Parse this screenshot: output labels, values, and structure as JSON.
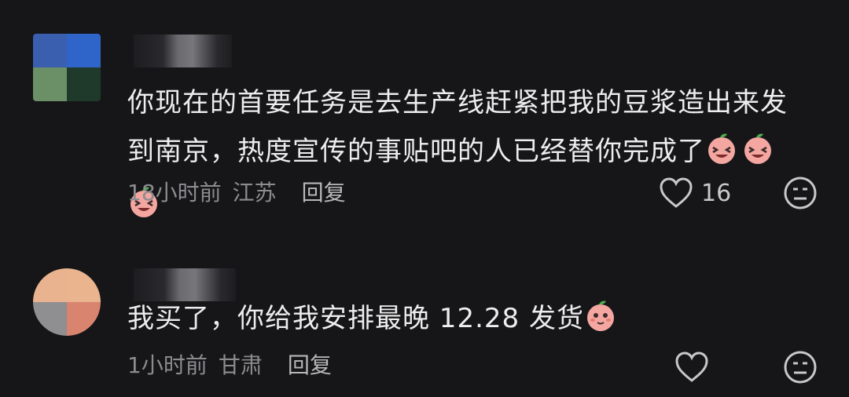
{
  "colors": {
    "background": "#161619",
    "text": "#ededed",
    "meta": "#8c8c8f",
    "emoji": "#f3a7a0"
  },
  "comments": [
    {
      "text": "你现在的首要任务是去生产线赶紧把我的豆浆造出来发到南京，热度宣传的事贴吧的人已经替你完成了",
      "emojis": [
        "laughing-peach-emoji",
        "laughing-peach-emoji",
        "laughing-peach-emoji"
      ],
      "time": "18小时前",
      "location": "江苏",
      "reply": "回复",
      "likes": "16"
    },
    {
      "text": "我买了，你给我安排最晚 12.28 发货",
      "emojis": [
        "shy-peach-emoji"
      ],
      "time": "1小时前",
      "location": "甘肃",
      "reply": "回复",
      "likes": ""
    }
  ]
}
